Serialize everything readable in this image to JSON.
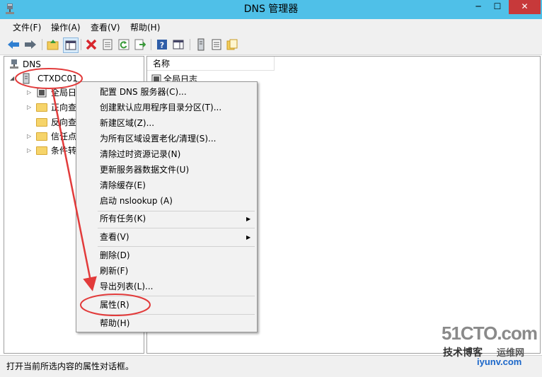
{
  "window": {
    "title": "DNS 管理器",
    "controls": {
      "minimize": "─",
      "maximize": "☐",
      "close": "✕"
    }
  },
  "menubar": {
    "items": [
      "文件(F)",
      "操作(A)",
      "查看(V)",
      "帮助(H)"
    ]
  },
  "toolbar": {
    "buttons": [
      "back-icon",
      "forward-icon",
      "up-folder-icon",
      "show-console-tree-icon",
      "delete-icon",
      "properties-icon",
      "refresh-icon",
      "export-list-icon",
      "help-icon",
      "show-action-pane-icon",
      "server-icon",
      "list-icon",
      "zone-icon"
    ]
  },
  "tree": {
    "root": "DNS",
    "server": "CTXDC01",
    "children": [
      "全局日",
      "正向查",
      "反向查",
      "信任点",
      "条件转"
    ]
  },
  "list": {
    "column_name": "名称",
    "rows": [
      "全局日志"
    ]
  },
  "context_menu": {
    "items": [
      "配置 DNS 服务器(C)...",
      "创建默认应用程序目录分区(T)...",
      "新建区域(Z)...",
      "为所有区域设置老化/清理(S)...",
      "清除过时资源记录(N)",
      "更新服务器数据文件(U)",
      "清除缓存(E)",
      "启动 nslookup (A)",
      "所有任务(K)",
      "查看(V)",
      "删除(D)",
      "刷新(F)",
      "导出列表(L)...",
      "属性(R)",
      "帮助(H)"
    ]
  },
  "status": {
    "text": "打开当前所选内容的属性对话框。"
  },
  "watermark": {
    "main": "51CTO.com",
    "sub": "技术博客",
    "sub2": "运维网",
    "url": "iyunv.com"
  },
  "colors": {
    "titlebar": "#4fc0e8",
    "close_button": "#c7393a",
    "annotation": "#e23b3b"
  }
}
